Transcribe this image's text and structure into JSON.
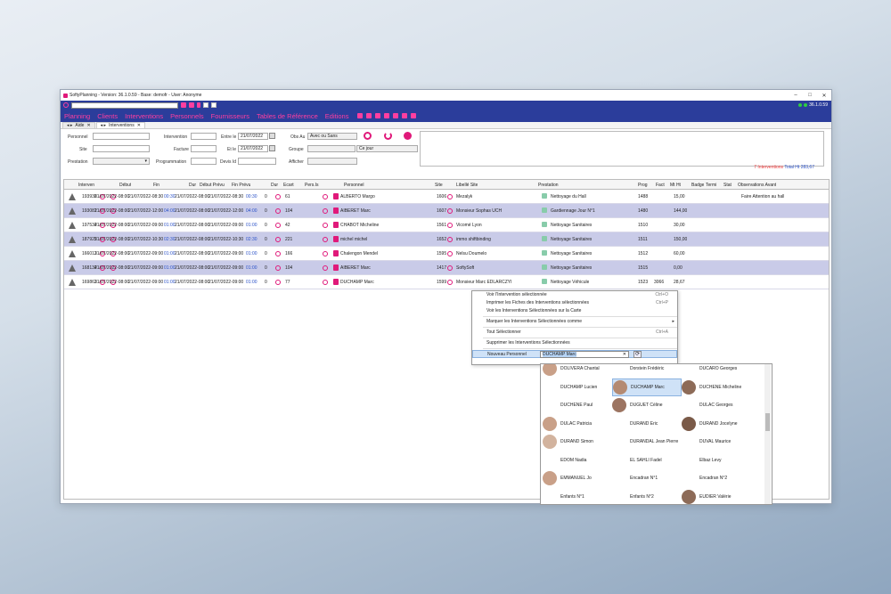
{
  "window": {
    "title": "SoftyPlanning - Version: 36.1.0.59 - Base: demofr - User: Anonyme",
    "version": "36.1.0.59"
  },
  "menu": [
    "Planning",
    "Clients",
    "Interventions",
    "Personnels",
    "Fournisseurs",
    "Tables de Référence",
    "Editions"
  ],
  "tabs": [
    {
      "label": "Aide"
    },
    {
      "label": "Interventions"
    }
  ],
  "filters": {
    "personnel": "Personnel",
    "site": "Site",
    "prestation": "Prestation",
    "intervention": "Intervention",
    "facture": "Facture",
    "programmation": "Programmation",
    "entre_le": "Entre le",
    "et_le": "Et le",
    "devis_id": "Devis Id",
    "date1": "21/07/2022",
    "date2": "21/07/2022",
    "obs_au": "Obs Au",
    "obs_value": "Avec ou Sans",
    "groupe": "Groupe",
    "groupe_value": "Ce jour",
    "afficher": "Afficher"
  },
  "totals": {
    "count": "7 Interventions",
    "total": "Total Ht 283,67"
  },
  "columns": [
    "Interven",
    "Début",
    "Fin",
    "Dur",
    "Début Prévu",
    "Fin Prévu",
    "Dur",
    "Ecart",
    "Pers.Is",
    "Personnel",
    "Site",
    "Libellé Site",
    "Prestation",
    "Prog",
    "Fact",
    "Mt Ht",
    "Badge",
    "Termi",
    "Stat",
    "Observations Avant"
  ],
  "rows": [
    {
      "id": "193938",
      "debut": "21/07/2022-08:00",
      "fin": "21/07/2022-08:30",
      "dur": "00:30",
      "debp": "21/07/2022-08:00",
      "finp": "21/07/2022-08:30",
      "durp": "00:30",
      "ecart": "0",
      "pers": "61",
      "personnel": "ALBERTO Margo",
      "site": "1606",
      "libsite": "Mezalyk",
      "prestation": "Nettoyage du Hall",
      "prog": "1488",
      "fact": "",
      "mt": "15,00",
      "obs": "Faire Attention au hall",
      "sel": false
    },
    {
      "id": "193081",
      "debut": "21/07/2022-08:00",
      "fin": "21/07/2022-12:00",
      "dur": "04:00",
      "debp": "21/07/2022-08:00",
      "finp": "21/07/2022-12:00",
      "durp": "04:00",
      "ecart": "0",
      "pers": "104",
      "personnel": "AIBERET Marc",
      "site": "1607",
      "libsite": "Monsieur Sophas UCH",
      "prestation": "Gardiennage Jour N°1",
      "prog": "1480",
      "fact": "",
      "mt": "144,00",
      "obs": "",
      "sel": true
    },
    {
      "id": "197534",
      "debut": "21/07/2022-08:00",
      "fin": "21/07/2022-09:00",
      "dur": "01:00",
      "debp": "21/07/2022-08:00",
      "finp": "21/07/2022-09:00",
      "durp": "01:00",
      "ecart": "0",
      "pers": "42",
      "personnel": "CHABOT Micheline",
      "site": "1561",
      "libsite": "Vicomé Lyon",
      "prestation": "Nettoyage Sanitaires",
      "prog": "1510",
      "fact": "",
      "mt": "30,00",
      "obs": "",
      "sel": false
    },
    {
      "id": "187925",
      "debut": "21/07/2022-08:00",
      "fin": "21/07/2022-10:30",
      "dur": "02:30",
      "debp": "21/07/2022-08:00",
      "finp": "21/07/2022-10:30",
      "durp": "02:30",
      "ecart": "0",
      "pers": "221",
      "personnel": "michel michel",
      "site": "1652",
      "libsite": "immo shiftbinding",
      "prestation": "Nettoyage Sanitaires",
      "prog": "1511",
      "fact": "",
      "mt": "150,00",
      "obs": "",
      "sel": true
    },
    {
      "id": "166013",
      "debut": "21/07/2022-08:00",
      "fin": "21/07/2022-09:00",
      "dur": "01:00",
      "debp": "21/07/2022-08:00",
      "finp": "21/07/2022-09:00",
      "durp": "01:00",
      "ecart": "0",
      "pers": "166",
      "personnel": "Chalengon Mendel",
      "site": "1595",
      "libsite": "Nelsu Doumelo",
      "prestation": "Nettoyage Sanitaires",
      "prog": "1512",
      "fact": "",
      "mt": "60,00",
      "obs": "",
      "sel": false
    },
    {
      "id": "168134",
      "debut": "21/07/2022-08:00",
      "fin": "21/07/2022-09:00",
      "dur": "01:00",
      "debp": "21/07/2022-08:00",
      "finp": "21/07/2022-09:00",
      "durp": "01:00",
      "ecart": "0",
      "pers": "104",
      "personnel": "AIBERET Marc",
      "site": "1417",
      "libsite": "SoftySoft",
      "prestation": "Nettoyage Sanitaires",
      "prog": "1515",
      "fact": "",
      "mt": "0,00",
      "obs": "",
      "sel": true
    },
    {
      "id": "169863",
      "debut": "21/07/2022-08:00",
      "fin": "21/07/2022-09:00",
      "dur": "01:00",
      "debp": "21/07/2022-08:00",
      "finp": "21/07/2022-09:00",
      "durp": "01:00",
      "ecart": "0",
      "pers": "77",
      "personnel": "DUCHAMP Marc",
      "site": "1599",
      "libsite": "Monsieur Marc EDLARCZYI",
      "prestation": "Nettoyage Véhicule",
      "prog": "1523",
      "fact": "3066",
      "mt": "28,67",
      "obs": "",
      "sel": false
    }
  ],
  "context_menu": [
    {
      "label": "Voir l'Intervention sélectionnée",
      "shortcut": "Ctrl+O"
    },
    {
      "label": "Imprimer les Fiches des Interventions sélectionnées",
      "shortcut": "Ctrl+P"
    },
    {
      "label": "Voir les Interventions Sélectionnées sur la Carte",
      "shortcut": ""
    },
    {
      "label": "Marquer les Interventions Sélectionnées comme",
      "shortcut": ""
    },
    {
      "label": "Tout Sélectionner",
      "shortcut": "Ctrl+A"
    },
    {
      "label": "Supprimer les Interventions Sélectionnées",
      "shortcut": ""
    },
    {
      "label": "Nouveau Personnel",
      "shortcut": ""
    }
  ],
  "nouveau_personnel_value": "DUCHAMP Marc",
  "personnel_list": [
    {
      "name": "DOLIVERA Chantal",
      "photo": true
    },
    {
      "name": "Dorstein Frédéric",
      "photo": false
    },
    {
      "name": "DUCARO Georges",
      "photo": false
    },
    {
      "name": "DUCHAMP Lucien",
      "photo": false
    },
    {
      "name": "DUCHAMP Marc",
      "photo": true
    },
    {
      "name": "DUCHENE Micheline",
      "photo": true
    },
    {
      "name": "DUCHENE Paul",
      "photo": false
    },
    {
      "name": "DUGUET Céline",
      "photo": true
    },
    {
      "name": "DULAC Georges",
      "photo": false
    },
    {
      "name": "DULAC Patricia",
      "photo": true
    },
    {
      "name": "DURAND Eric",
      "photo": false
    },
    {
      "name": "DURAND Jocelyne",
      "photo": true
    },
    {
      "name": "DURAND Simon",
      "photo": true
    },
    {
      "name": "DURANDAL Jean Pierre",
      "photo": false
    },
    {
      "name": "DUVAL Maurice",
      "photo": false
    },
    {
      "name": "EDOM Nadia",
      "photo": false
    },
    {
      "name": "EL SAHLI Fadel",
      "photo": false
    },
    {
      "name": "Elbaz Levy",
      "photo": false
    },
    {
      "name": "EMMANUEL Jo",
      "photo": true
    },
    {
      "name": "Encadran N°1",
      "photo": false
    },
    {
      "name": "Encadran N°2",
      "photo": false
    },
    {
      "name": "Enfants N°1",
      "photo": false
    },
    {
      "name": "Enfants N°2",
      "photo": false
    },
    {
      "name": "EUDIER Valérie",
      "photo": true
    }
  ]
}
